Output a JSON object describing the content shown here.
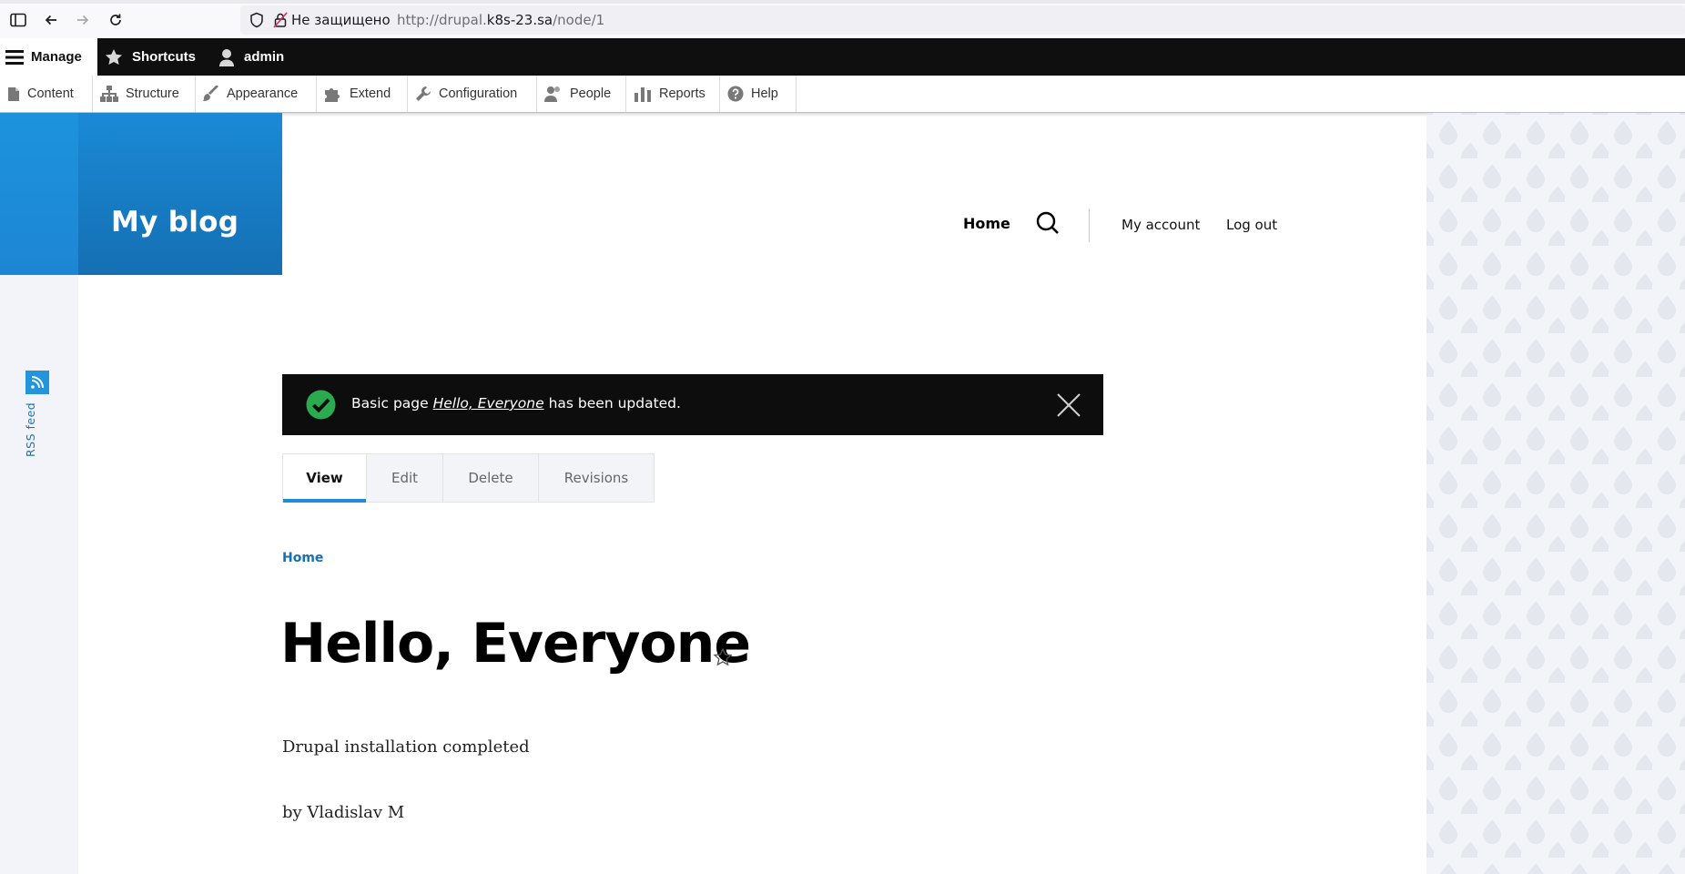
{
  "browser": {
    "not_secure": "Не защищено",
    "url_prefix": "http://drupal.",
    "url_host": "k8s-23.sa",
    "url_path": "/node/1"
  },
  "toolbar": {
    "manage": "Manage",
    "shortcuts": "Shortcuts",
    "admin": "admin",
    "tray": [
      {
        "label": "Content"
      },
      {
        "label": "Structure"
      },
      {
        "label": "Appearance"
      },
      {
        "label": "Extend"
      },
      {
        "label": "Configuration"
      },
      {
        "label": "People"
      },
      {
        "label": "Reports"
      },
      {
        "label": "Help"
      }
    ]
  },
  "site": {
    "name": "My blog"
  },
  "nav": {
    "home": "Home",
    "my_account": "My account",
    "log_out": "Log out"
  },
  "rss": {
    "label": "RSS feed"
  },
  "message": {
    "prefix": "Basic page ",
    "link": "Hello, Everyone",
    "suffix": " has been updated."
  },
  "tabs": [
    {
      "label": "View",
      "active": true
    },
    {
      "label": "Edit"
    },
    {
      "label": "Delete"
    },
    {
      "label": "Revisions"
    }
  ],
  "breadcrumb": "Home",
  "page": {
    "title": "Hello, Everyone",
    "body": "Drupal installation completed",
    "byline": "by Vladislav M"
  },
  "colors": {
    "accent": "#1f8dd6",
    "brand": "#1a8ad6",
    "toolbar": "#0f0f0f",
    "success": "#2bab4f"
  }
}
